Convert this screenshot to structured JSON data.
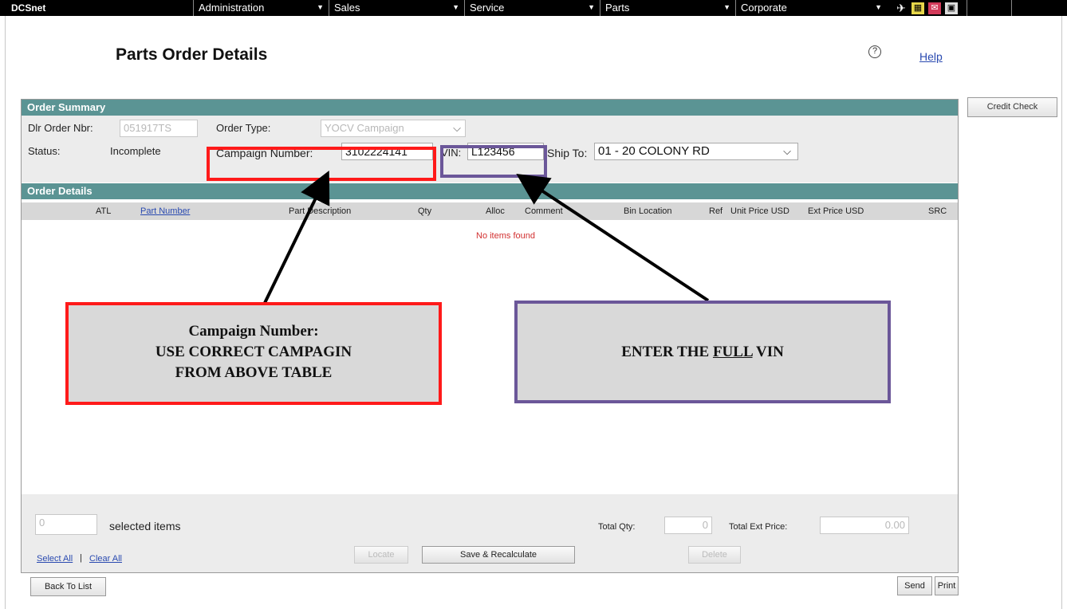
{
  "topbar": {
    "brand": "DCSnet",
    "menus": [
      {
        "label": "Administration"
      },
      {
        "label": "Sales"
      },
      {
        "label": "Service"
      },
      {
        "label": "Parts"
      },
      {
        "label": "Corporate"
      }
    ],
    "icons": [
      "pin-icon",
      "note-icon",
      "mail-icon",
      "grid-icon"
    ]
  },
  "page": {
    "title": "Parts Order Details",
    "help_label": "Help",
    "credit_check_label": "Credit Check"
  },
  "summary": {
    "header": "Order Summary",
    "dlr_order_label": "Dlr Order Nbr:",
    "dlr_order_value": "051917TS",
    "order_type_label": "Order Type:",
    "order_type_value": "YOCV Campaign",
    "status_label": "Status:",
    "status_value": "Incomplete",
    "campaign_label": "Campaign Number:",
    "campaign_value": "3102224141",
    "vin_label": "VIN:",
    "vin_value": "L123456",
    "ship_to_label": "Ship To:",
    "ship_to_value": "01 - 20 COLONY RD"
  },
  "details": {
    "header": "Order Details",
    "columns": {
      "atl": "ATL",
      "part_number": "Part Number",
      "part_description": "Part Description",
      "qty": "Qty",
      "alloc": "Alloc",
      "comment": "Comment",
      "bin_location": "Bin Location",
      "ref": "Ref",
      "unit_price": "Unit Price USD",
      "ext_price": "Ext Price USD",
      "src": "SRC"
    },
    "empty_message": "No items found"
  },
  "footer": {
    "selected_count": "0",
    "selected_label": "selected items",
    "total_qty_label": "Total Qty:",
    "total_qty_value": "0",
    "total_ext_label": "Total Ext Price:",
    "total_ext_value": "0.00",
    "select_all": "Select All",
    "separator": "|",
    "clear_all": "Clear All",
    "locate": "Locate",
    "save_recalc": "Save & Recalculate",
    "delete": "Delete"
  },
  "actions": {
    "back_to_list": "Back To List",
    "send": "Send",
    "print": "Print"
  },
  "annotations": {
    "campaign_callout_line1": "Campaign Number:",
    "campaign_callout_line2": "USE CORRECT CAMPAGIN",
    "campaign_callout_line3": "FROM  ABOVE TABLE",
    "vin_callout_pre": "ENTER THE ",
    "vin_callout_emph": "FULL",
    "vin_callout_post": " VIN",
    "colors": {
      "red": "#ff1a1a",
      "purple": "#6b5799",
      "teal": "#5b9494"
    }
  }
}
